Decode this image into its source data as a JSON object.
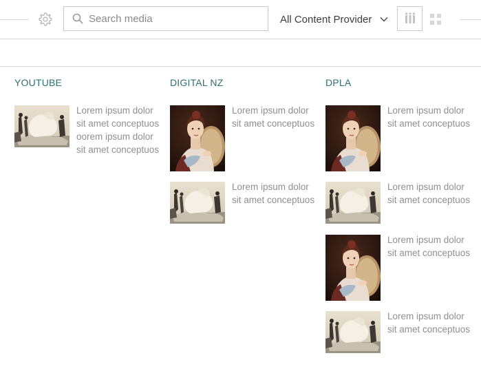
{
  "search": {
    "placeholder": "Search media",
    "value": ""
  },
  "provider_select": {
    "selected": "All Content Provider"
  },
  "columns": [
    {
      "title": "YOUTUBE",
      "items": [
        {
          "image": "horse-sculpture",
          "caption": "Lorem ipsum dolor sit amet conceptuos oorem ipsum dolor sit amet conceptuos"
        }
      ]
    },
    {
      "title": "DIGITAL NZ",
      "items": [
        {
          "image": "woman-portrait",
          "caption": "Lorem ipsum dolor sit amet conceptuos"
        },
        {
          "image": "horse-sculpture",
          "caption": "Lorem ipsum dolor sit amet conceptuos"
        }
      ]
    },
    {
      "title": "DPLA",
      "items": [
        {
          "image": "woman-portrait",
          "caption": "Lorem ipsum dolor sit amet conceptuos"
        },
        {
          "image": "horse-sculpture",
          "caption": "Lorem ipsum dolor sit amet conceptuos"
        },
        {
          "image": "woman-portrait",
          "caption": "Lorem ipsum dolor sit amet conceptuos"
        },
        {
          "image": "horse-sculpture",
          "caption": "Lorem ipsum dolor sit amet conceptuos"
        }
      ]
    }
  ],
  "icons": {
    "settings": "gear-icon",
    "search": "search-icon",
    "dropdown": "chevron-down-icon",
    "list_view": "list-view-icon",
    "grid_view": "grid-view-icon"
  },
  "colors": {
    "heading": "#2f6f72",
    "caption": "#8f8f8f",
    "border": "#c9c9c9",
    "divider": "#d6d6d6"
  }
}
